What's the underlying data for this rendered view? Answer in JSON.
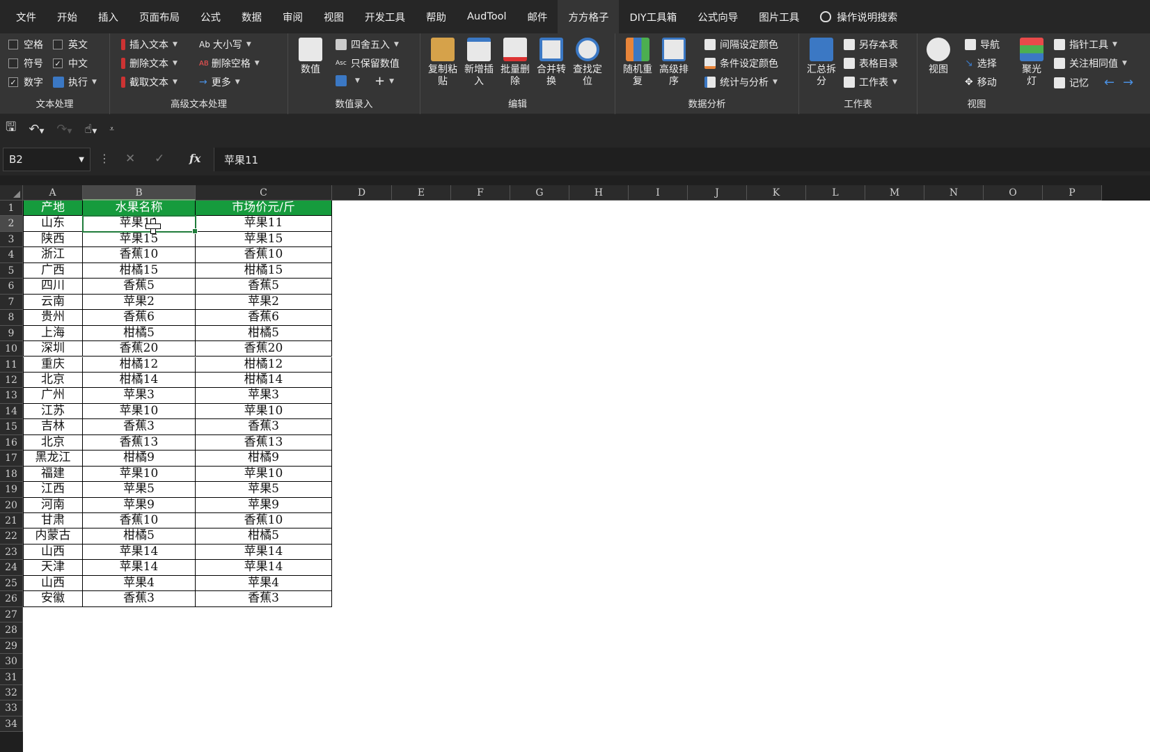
{
  "tabs": [
    "文件",
    "开始",
    "插入",
    "页面布局",
    "公式",
    "数据",
    "审阅",
    "视图",
    "开发工具",
    "帮助",
    "AudTool",
    "邮件",
    "方方格子",
    "DIY工具箱",
    "公式向导",
    "图片工具",
    "操作说明搜索"
  ],
  "ribbon": {
    "text_processing": {
      "label": "文本处理",
      "checks": [
        {
          "label": "空格",
          "checked": false
        },
        {
          "label": "英文",
          "checked": false
        },
        {
          "label": "符号",
          "checked": false
        },
        {
          "label": "中文",
          "checked": true
        },
        {
          "label": "数字",
          "checked": true
        }
      ],
      "execute": "执行"
    },
    "advanced_text": {
      "label": "高级文本处理",
      "items": [
        "插入文本",
        "删除文本",
        "截取文本",
        "大小写",
        "删除空格",
        "更多"
      ]
    },
    "data_entry": {
      "label": "数值录入",
      "value_btn": "数值",
      "items": [
        "四舍五入",
        "只保留数值"
      ]
    },
    "edit": {
      "label": "编辑",
      "buttons": [
        {
          "l1": "复制粘",
          "l2": "贴"
        },
        {
          "l1": "新增插",
          "l2": "入"
        },
        {
          "l1": "批量删",
          "l2": "除"
        },
        {
          "l1": "合并转",
          "l2": "换"
        },
        {
          "l1": "查找定",
          "l2": "位"
        }
      ]
    },
    "analysis": {
      "label": "数据分析",
      "buttons": [
        {
          "l1": "随机重",
          "l2": "复"
        },
        {
          "l1": "高级排",
          "l2": "序"
        }
      ],
      "items": [
        "间隔设定颜色",
        "条件设定颜色",
        "统计与分析"
      ]
    },
    "sheet": {
      "label": "工作表",
      "summary": {
        "l1": "汇总拆",
        "l2": "分"
      },
      "items": [
        "另存本表",
        "表格目录",
        "工作表"
      ]
    },
    "view": {
      "label": "视图",
      "view_btn": "视图",
      "items": [
        "导航",
        "选择",
        "移动"
      ],
      "spotlight": {
        "l1": "聚光",
        "l2": "灯"
      },
      "right_items": [
        "指针工具",
        "关注相同值",
        "记忆"
      ]
    }
  },
  "formula_bar": {
    "name_box": "B2",
    "formula": "苹果11"
  },
  "grid": {
    "columns": [
      "A",
      "B",
      "C",
      "D",
      "E",
      "F",
      "G",
      "H",
      "I",
      "J",
      "K",
      "L",
      "M",
      "N",
      "O",
      "P"
    ],
    "row_count": 34,
    "selected_cell": "B2",
    "header": [
      "产地",
      "水果名称",
      "市场价元/斤"
    ],
    "rows": [
      [
        "山东",
        "苹果11",
        "苹果11"
      ],
      [
        "陕西",
        "苹果15",
        "苹果15"
      ],
      [
        "浙江",
        "香蕉10",
        "香蕉10"
      ],
      [
        "广西",
        "柑橘15",
        "柑橘15"
      ],
      [
        "四川",
        "香蕉5",
        "香蕉5"
      ],
      [
        "云南",
        "苹果2",
        "苹果2"
      ],
      [
        "贵州",
        "香蕉6",
        "香蕉6"
      ],
      [
        "上海",
        "柑橘5",
        "柑橘5"
      ],
      [
        "深圳",
        "香蕉20",
        "香蕉20"
      ],
      [
        "重庆",
        "柑橘12",
        "柑橘12"
      ],
      [
        "北京",
        "柑橘14",
        "柑橘14"
      ],
      [
        "广州",
        "苹果3",
        "苹果3"
      ],
      [
        "江苏",
        "苹果10",
        "苹果10"
      ],
      [
        "吉林",
        "香蕉3",
        "香蕉3"
      ],
      [
        "北京",
        "香蕉13",
        "香蕉13"
      ],
      [
        "黑龙江",
        "柑橘9",
        "柑橘9"
      ],
      [
        "福建",
        "苹果10",
        "苹果10"
      ],
      [
        "江西",
        "苹果5",
        "苹果5"
      ],
      [
        "河南",
        "苹果9",
        "苹果9"
      ],
      [
        "甘肃",
        "香蕉10",
        "香蕉10"
      ],
      [
        "内蒙古",
        "柑橘5",
        "柑橘5"
      ],
      [
        "山西",
        "苹果14",
        "苹果14"
      ],
      [
        "天津",
        "苹果14",
        "苹果14"
      ],
      [
        "山西",
        "苹果4",
        "苹果4"
      ],
      [
        "安徽",
        "香蕉3",
        "香蕉3"
      ]
    ]
  }
}
